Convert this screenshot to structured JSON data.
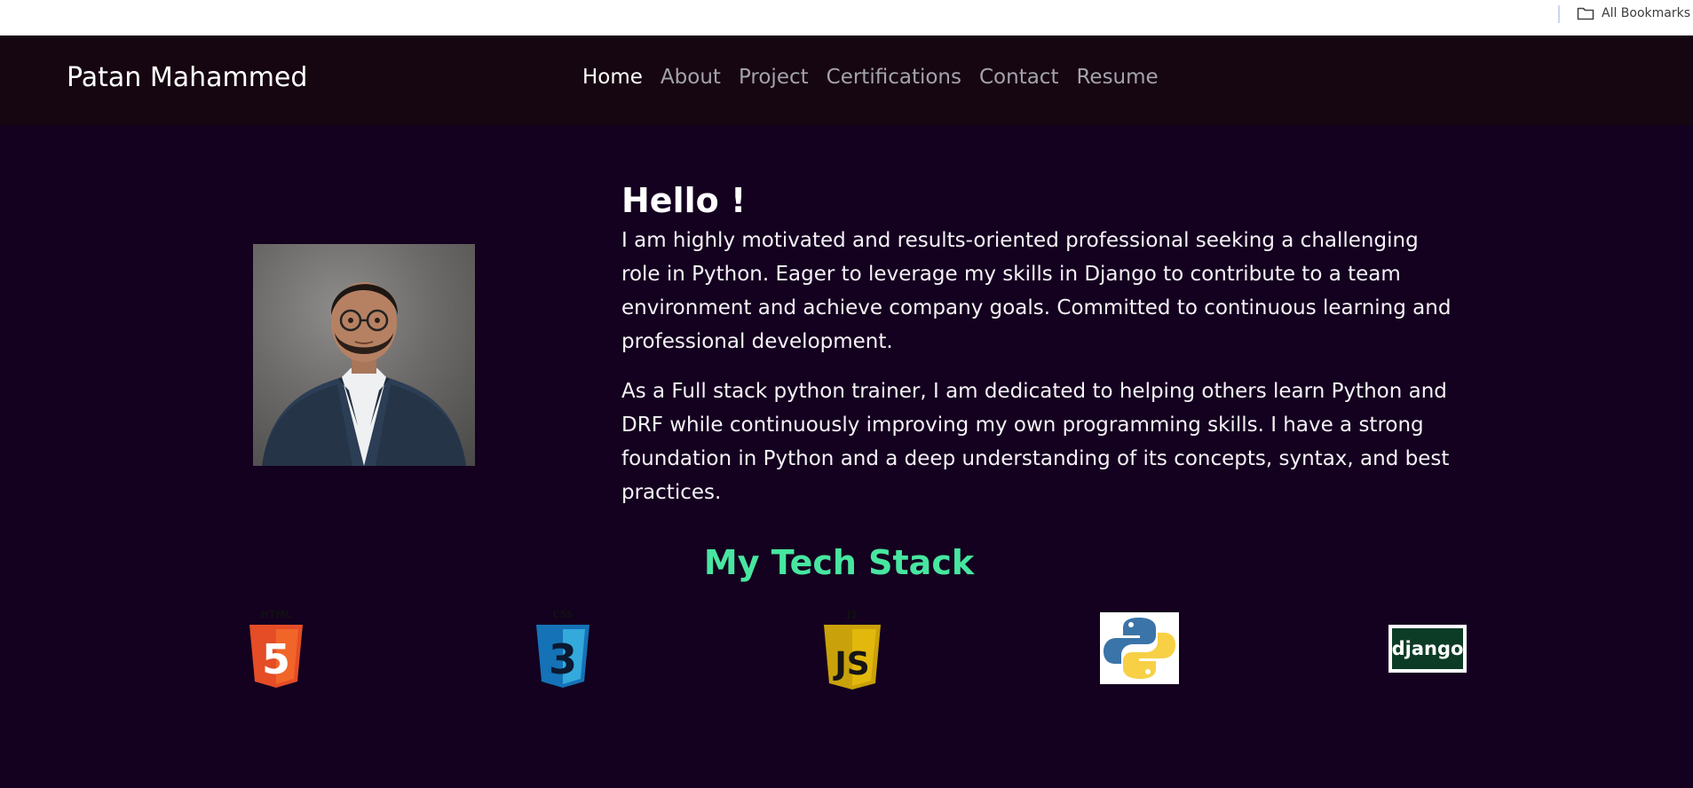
{
  "bookmarks": {
    "all_bookmarks_label": "All Bookmarks",
    "icon": "folder-icon"
  },
  "navbar": {
    "brand": "Patan Mahammed",
    "links": [
      {
        "label": "Home",
        "active": true
      },
      {
        "label": "About",
        "active": false
      },
      {
        "label": "Project",
        "active": false
      },
      {
        "label": "Certifications",
        "active": false
      },
      {
        "label": "Contact",
        "active": false
      },
      {
        "label": "Resume",
        "active": false
      }
    ]
  },
  "hero": {
    "title": "Hello !",
    "paragraphs": [
      "I am highly motivated and results-oriented professional seeking a challenging role in Python. Eager to leverage my skills in Django to contribute to a team environment and achieve company goals. Committed to continuous learning and professional development.",
      "As a Full stack python trainer, I am dedicated to helping others learn Python and DRF while continuously improving my own programming skills. I have a strong foundation in Python and a deep understanding of its concepts, syntax, and best practices."
    ]
  },
  "tech_stack": {
    "title": "My Tech Stack",
    "items": [
      {
        "name": "html5-logo",
        "text": "HTML",
        "badge": "5"
      },
      {
        "name": "css3-logo",
        "text": "CSS",
        "badge": "3"
      },
      {
        "name": "javascript-logo",
        "text": "JS",
        "badge": "JS"
      },
      {
        "name": "python-logo"
      },
      {
        "name": "django-logo",
        "text": "django"
      }
    ]
  },
  "colors": {
    "background": "#14001f",
    "navbar": "#160611",
    "accent_green": "#47e6a0",
    "html_orange": "#e44d26",
    "css_blue": "#1572b6",
    "js_yellow": "#c9a10a",
    "django_green": "#0c3c26"
  }
}
